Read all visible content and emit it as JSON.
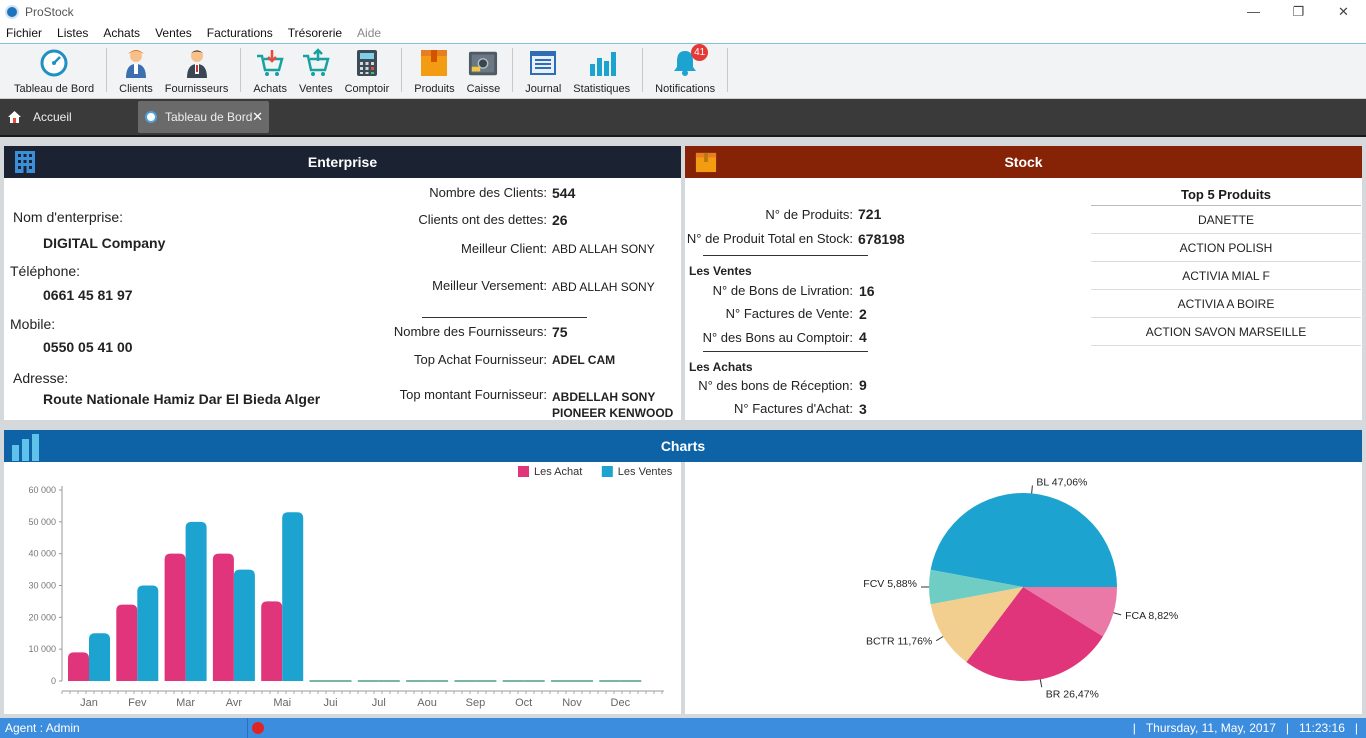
{
  "window": {
    "title": "ProStock",
    "minimize": "—",
    "restore": "❐",
    "close": "✕"
  },
  "menu": [
    "Fichier",
    "Listes",
    "Achats",
    "Ventes",
    "Facturations",
    "Trésorerie",
    "Aide"
  ],
  "toolbar": {
    "dashboard": "Tableau de Bord",
    "clients": "Clients",
    "suppliers": "Fournisseurs",
    "purchases": "Achats",
    "sales": "Ventes",
    "counter": "Comptoir",
    "products": "Produits",
    "cash": "Caisse",
    "journal": "Journal",
    "stats": "Statistiques",
    "notifications": "Notifications",
    "notif_count": "41"
  },
  "tabs": {
    "home": "Accueil",
    "active": "Tableau de Bord",
    "close": "✕"
  },
  "enterprise": {
    "header": "Enterprise",
    "name_label": "Nom d'enterprise:",
    "name": "DIGITAL Company",
    "phone_label": "Téléphone:",
    "phone": "0661 45 81 97",
    "mobile_label": "Mobile:",
    "mobile": "0550 05 41 00",
    "address_label": "Adresse:",
    "address": "Route Nationale Hamiz Dar El Bieda Alger",
    "clients_count_label": "Nombre des Clients:",
    "clients_count": "544",
    "clients_debt_label": "Clients ont des dettes:",
    "clients_debt": "26",
    "best_client_label": "Meilleur Client:",
    "best_client": "ABD ALLAH SONY",
    "best_payment_label": "Meilleur Versement:",
    "best_payment": "ABD ALLAH SONY",
    "suppliers_count_label": "Nombre des Fournisseurs:",
    "suppliers_count": "75",
    "top_supplier_label": "Top Achat Fournisseur:",
    "top_supplier": "ADEL CAM",
    "top_amount_label": "Top montant Fournisseur:",
    "top_amount_line1": "ABDELLAH SONY",
    "top_amount_line2": "PIONEER KENWOOD"
  },
  "stock": {
    "header": "Stock",
    "products_label": "N°  de Produits:",
    "products": "721",
    "total_stock_label": "N° de Produit Total en Stock:",
    "total_stock": "678198",
    "sales_heading": "Les Ventes",
    "delivery_label": "N° de Bons de Livration:",
    "delivery": "16",
    "sales_invoices_label": "N° Factures de Vente:",
    "sales_invoices": "2",
    "counter_label": "N° des Bons au Comptoir:",
    "counter": "4",
    "purchases_heading": "Les Achats",
    "reception_label": "N° des bons de Réception:",
    "reception": "9",
    "purchase_invoices_label": "N° Factures d'Achat:",
    "purchase_invoices": "3",
    "top5_title": "Top 5 Produits",
    "top5": [
      "DANETTE",
      "ACTION POLISH",
      "ACTIVIA MIAL F",
      "ACTIVIA A BOIRE",
      "ACTION SAVON MARSEILLE"
    ]
  },
  "charts_header": "Charts",
  "chart_data": [
    {
      "type": "bar",
      "categories": [
        "Jan",
        "Fev",
        "Mar",
        "Avr",
        "Mai",
        "Jui",
        "Jul",
        "Aou",
        "Sep",
        "Oct",
        "Nov",
        "Dec"
      ],
      "series": [
        {
          "name": "Les Achat",
          "color": "#e0357a",
          "values": [
            9000,
            24000,
            40000,
            40000,
            25000,
            0,
            0,
            0,
            0,
            0,
            0,
            0
          ]
        },
        {
          "name": "Les Ventes",
          "color": "#1ca3cf",
          "values": [
            15000,
            30000,
            50000,
            35000,
            53000,
            0,
            0,
            0,
            0,
            0,
            0,
            0
          ]
        }
      ],
      "yticks": [
        "0",
        "10 000",
        "20 000",
        "30 000",
        "40 000",
        "50 000",
        "60 000"
      ],
      "ylim": [
        0,
        60000
      ],
      "legend": "top-right"
    },
    {
      "type": "pie",
      "slices": [
        {
          "label": "BL 47,06%",
          "value": 47.06,
          "color": "#1ca3cf"
        },
        {
          "label": "FCA 8,82%",
          "value": 8.82,
          "color": "#ea79a8"
        },
        {
          "label": "BR 26,47%",
          "value": 26.47,
          "color": "#e0357a"
        },
        {
          "label": "BCTR 11,76%",
          "value": 11.76,
          "color": "#f2cf8e"
        },
        {
          "label": "FCV 5,88%",
          "value": 5.88,
          "color": "#6fcdc3"
        }
      ]
    }
  ],
  "status": {
    "agent": "Agent : Admin",
    "date": "Thursday, 11,  May, 2017",
    "time": "11:23:16",
    "sep": "|"
  }
}
